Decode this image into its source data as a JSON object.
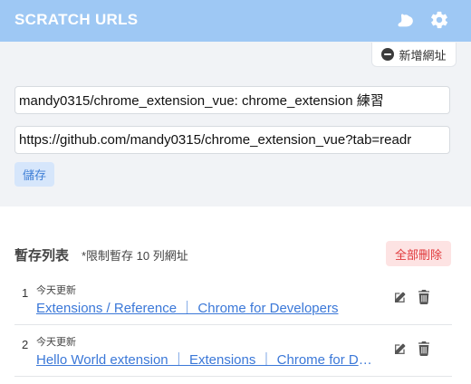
{
  "header": {
    "title": "SCRATCH URLS",
    "icons": [
      "cat-icon",
      "gear-icon"
    ],
    "bg_color": "#9ec8f4"
  },
  "form": {
    "add_button_label": "新增網址",
    "title_value": "mandy0315/chrome_extension_vue: chrome_extension 練習",
    "url_value": "https://github.com/mandy0315/chrome_extension_vue?tab=readr",
    "save_label": "儲存"
  },
  "list": {
    "title": "暫存列表",
    "note": "*限制暫存 10 列網址",
    "delete_all_label": "全部刪除",
    "items": [
      {
        "num": "1",
        "date": "今天更新",
        "link": "Extensions / Reference ｜ Chrome for Developers"
      },
      {
        "num": "2",
        "date": "今天更新",
        "link": "Hello World extension ｜ Extensions ｜ Chrome for Developers"
      }
    ]
  },
  "colors": {
    "accent": "#3b78d8",
    "danger": "#e0383b"
  }
}
